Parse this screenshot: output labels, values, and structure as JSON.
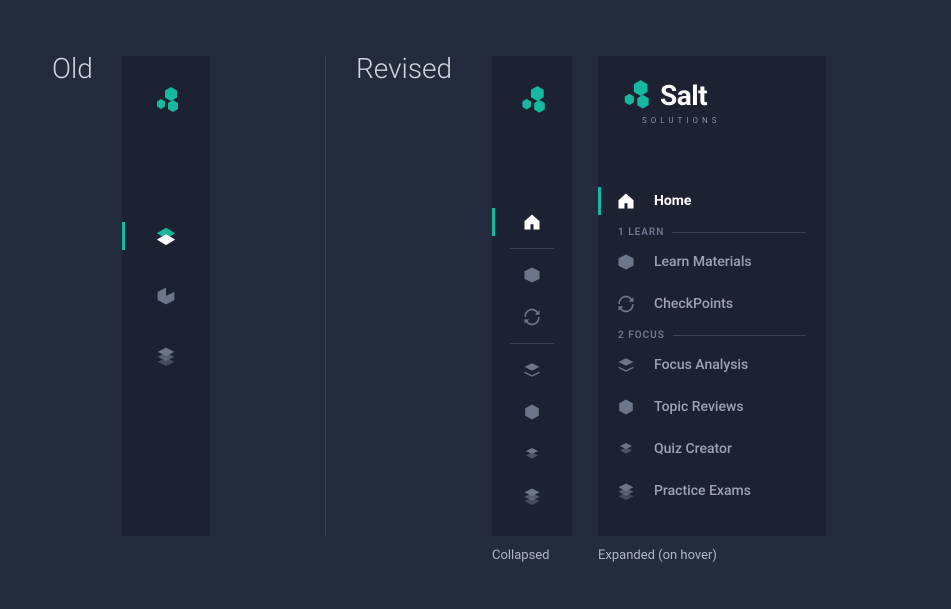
{
  "labels": {
    "old": "Old",
    "revised": "Revised",
    "collapsed": "Collapsed",
    "expanded": "Expanded (on hover)"
  },
  "brand": {
    "name": "Salt",
    "sub": "SOLUTIONS"
  },
  "sections": {
    "learn": "1 LEARN",
    "focus": "2 FOCUS"
  },
  "nav": {
    "home": "Home",
    "learn_materials": "Learn Materials",
    "checkpoints": "CheckPoints",
    "focus_analysis": "Focus Analysis",
    "topic_reviews": "Topic Reviews",
    "quiz_creator": "Quiz Creator",
    "practice_exams": "Practice Exams"
  },
  "colors": {
    "accent": "#16b8a0",
    "bg": "#232b3c",
    "panel": "#1c2231"
  }
}
